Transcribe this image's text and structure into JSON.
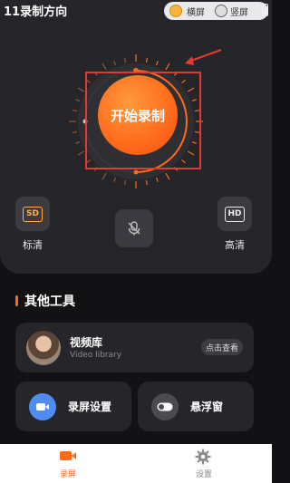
{
  "status_bar": {
    "title": "11录制方向",
    "pill_label_1": "横屏",
    "pill_label_2": "竖屏"
  },
  "record": {
    "button_label": "开始录制"
  },
  "quality": {
    "sd_badge": "SD",
    "sd_label": "标清",
    "hd_badge": "HD",
    "hd_label": "高清"
  },
  "tools": {
    "section_title": "其他工具",
    "video_library": {
      "title": "视频库",
      "subtitle": "Video library",
      "button": "点击查看"
    },
    "record_settings": "录屏设置",
    "floating_window": "悬浮窗"
  },
  "tab_bar": {
    "record": "录屏",
    "settings": "设置"
  },
  "colors": {
    "accent": "#ff6a1a",
    "highlight_box": "#e03b2f",
    "blue_icon": "#4e8cf3"
  }
}
